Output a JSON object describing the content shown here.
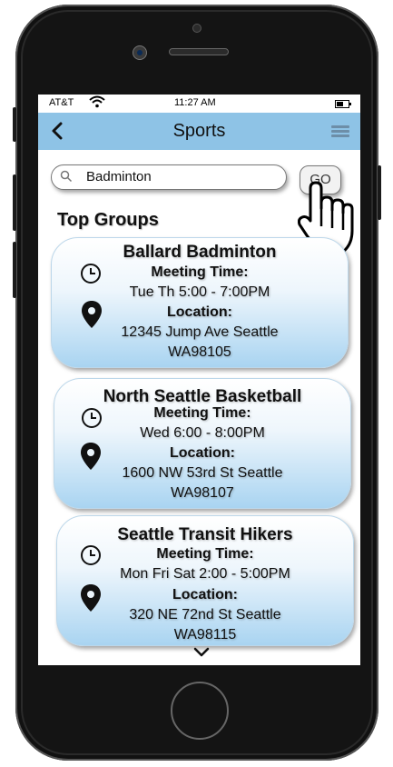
{
  "status_bar": {
    "carrier": "AT&T",
    "time": "11:27 AM"
  },
  "nav": {
    "title": "Sports"
  },
  "search": {
    "value": "Badminton"
  },
  "go_button": {
    "label": "GO"
  },
  "section_title": "Top Groups",
  "groups": [
    {
      "name": "Ballard Badminton",
      "meeting_label": "Meeting Time:",
      "meeting_time": "Tue Th 5:00 - 7:00PM",
      "location_label": "Location:",
      "address_line1": "12345 Jump Ave Seattle",
      "address_line2": "WA98105"
    },
    {
      "name": "North Seattle Basketball",
      "meeting_label": "Meeting Time:",
      "meeting_time": "Wed 6:00 - 8:00PM",
      "location_label": "Location:",
      "address_line1": "1600 NW 53rd St Seattle",
      "address_line2": "WA98107"
    },
    {
      "name": "Seattle Transit Hikers",
      "meeting_label": "Meeting Time:",
      "meeting_time": "Mon Fri Sat 2:00 - 5:00PM",
      "location_label": "Location:",
      "address_line1": "320 NE 72nd St Seattle",
      "address_line2": "WA98115"
    }
  ],
  "colors": {
    "navbar": "#8ec3e6",
    "card_gradient_bottom": "#a9d4f1"
  }
}
